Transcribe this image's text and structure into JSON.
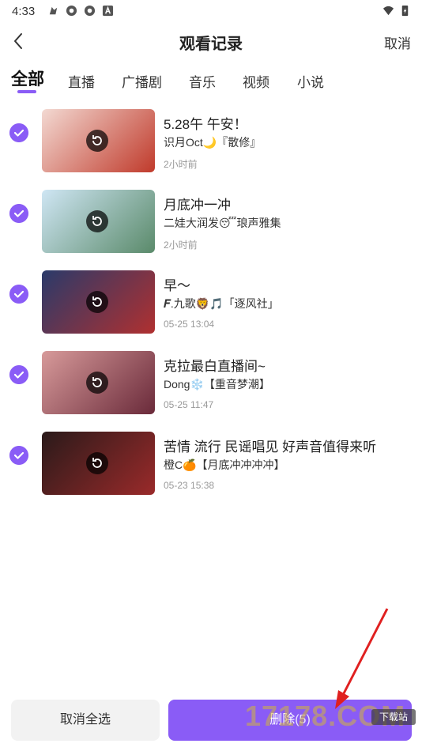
{
  "status_bar": {
    "time": "4:33"
  },
  "header": {
    "title": "观看记录",
    "cancel_label": "取消"
  },
  "tabs": [
    {
      "label": "全部",
      "active": true
    },
    {
      "label": "直播"
    },
    {
      "label": "广播剧"
    },
    {
      "label": "音乐"
    },
    {
      "label": "视频"
    },
    {
      "label": "小说"
    }
  ],
  "records": [
    {
      "title": "5.28午 午安！",
      "host": "识月Oct🌙『散修』",
      "time": "2小时前",
      "thumb_colors": [
        "#f3d9d2",
        "#c03a2b"
      ]
    },
    {
      "title": "月底冲一冲",
      "host": "二娃大润发😴琅声雅集",
      "time": "2小时前",
      "thumb_colors": [
        "#cfe6f4",
        "#5a8a6a"
      ]
    },
    {
      "title": "早～",
      "host": "𝑭.九歌🦁🎵「逐风社」",
      "time": "05-25 13:04",
      "thumb_colors": [
        "#2a3a6a",
        "#b03030"
      ]
    },
    {
      "title": "克拉最白直播间~",
      "host": "Dong❄️【重音梦潮】",
      "time": "05-25 11:47",
      "thumb_colors": [
        "#d79a9a",
        "#6a2a3a"
      ]
    },
    {
      "title": "苦情 流行 民谣唱见 好声音值得来听",
      "host": "橙C🍊【月底冲冲冲冲】",
      "time": "05-23 15:38",
      "thumb_colors": [
        "#2a1a1a",
        "#9a2a2a"
      ]
    }
  ],
  "bottom": {
    "select_cancel_label": "取消全选",
    "delete_label": "删除",
    "delete_count": "(5)"
  },
  "watermark": {
    "text": "17178.COM",
    "badge": "下载站"
  },
  "colors": {
    "accent": "#8a5cf6",
    "arrow": "#e02020"
  }
}
